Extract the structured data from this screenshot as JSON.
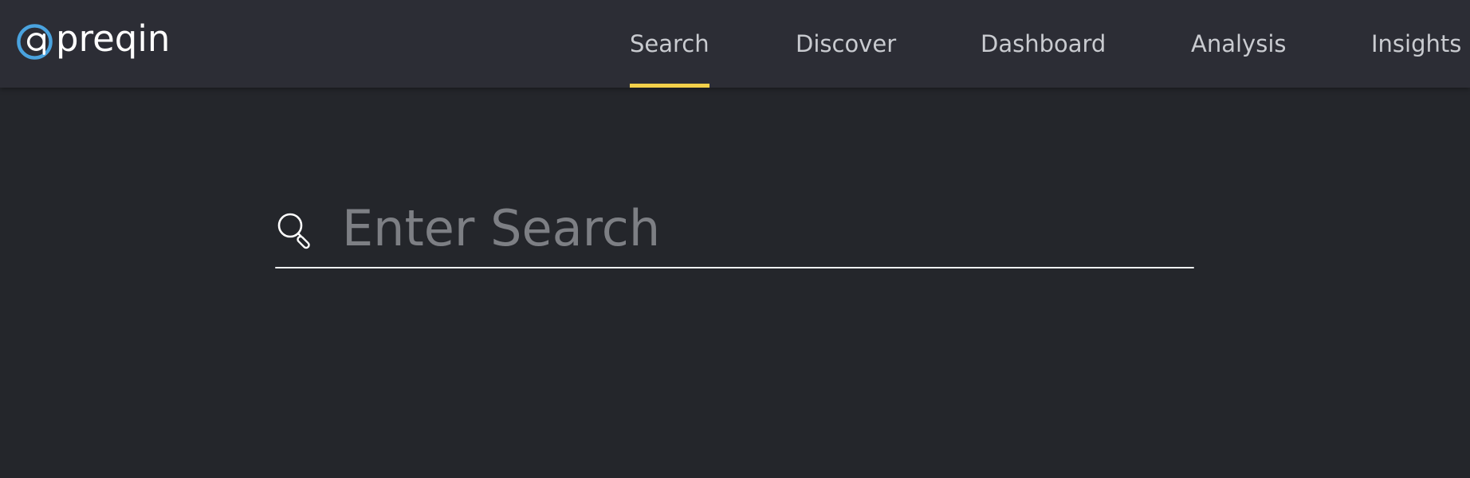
{
  "brand": {
    "name": "preqin",
    "logo_icon": "preqin-at-logo-icon",
    "accent_color": "#4aa3df"
  },
  "nav": {
    "items": [
      {
        "label": "Search",
        "active": true
      },
      {
        "label": "Discover",
        "active": false
      },
      {
        "label": "Dashboard",
        "active": false
      },
      {
        "label": "Analysis",
        "active": false
      },
      {
        "label": "Insights",
        "active": false
      }
    ],
    "active_underline_color": "#f2d04a"
  },
  "search": {
    "placeholder": "Enter Search",
    "value": "",
    "icon": "search-icon"
  },
  "colors": {
    "background": "#24262b",
    "topbar": "#2c2d35",
    "nav_text": "#c9cbd0",
    "placeholder": "#7d7f84",
    "input_line": "#eef0f2"
  }
}
